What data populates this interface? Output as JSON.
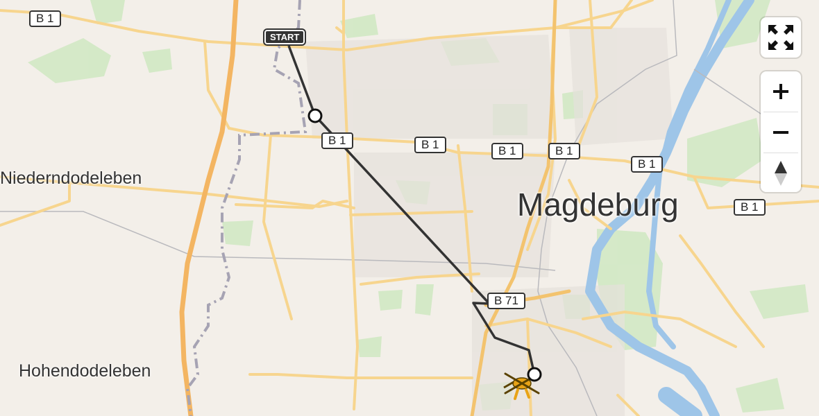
{
  "map": {
    "city_label": "Magdeburg",
    "places": [
      "Niederndodeleben",
      "Hohendodeleben"
    ],
    "road_labels": [
      "B 1",
      "B 1",
      "B 1",
      "B 1",
      "B 1",
      "B 1",
      "B 1",
      "B 71"
    ],
    "route_start_label": "START"
  },
  "controls": {
    "fullscreen_icon": "fullscreen-icon",
    "zoom_in_icon": "plus-icon",
    "zoom_out_icon": "minus-icon",
    "north_icon": "compass-north-icon"
  },
  "colors": {
    "background": "#f3efe9",
    "road_major": "#f7d58e",
    "road_motorway": "#f3b562",
    "water": "#9ec5e8",
    "green": "#cfe8c2",
    "route": "#333333",
    "helicopter": "#e8a317"
  }
}
